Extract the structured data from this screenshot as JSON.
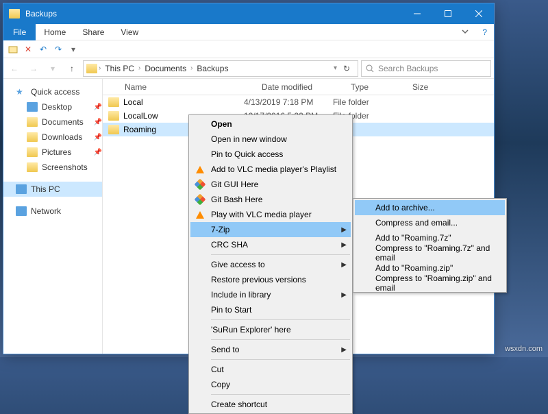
{
  "titlebar": {
    "title": "Backups"
  },
  "menubar": {
    "file": "File",
    "home": "Home",
    "share": "Share",
    "view": "View"
  },
  "address": {
    "crumb1": "This PC",
    "crumb2": "Documents",
    "crumb3": "Backups",
    "search_placeholder": "Search Backups"
  },
  "sidebar": {
    "quick_access": "Quick access",
    "desktop": "Desktop",
    "documents": "Documents",
    "downloads": "Downloads",
    "pictures": "Pictures",
    "screenshots": "Screenshots",
    "this_pc": "This PC",
    "network": "Network"
  },
  "columns": {
    "name": "Name",
    "date": "Date modified",
    "type": "Type",
    "size": "Size"
  },
  "rows": [
    {
      "name": "Local",
      "date": "4/13/2019 7:18 PM",
      "type": "File folder"
    },
    {
      "name": "LocalLow",
      "date": "12/17/2016 5:22 PM",
      "type": "File folder"
    },
    {
      "name": "Roaming",
      "date": "",
      "type": ""
    }
  ],
  "context_menu": {
    "open": "Open",
    "open_new_window": "Open in new window",
    "pin_quick": "Pin to Quick access",
    "vlc_playlist": "Add to VLC media player's Playlist",
    "git_gui": "Git GUI Here",
    "git_bash": "Git Bash Here",
    "vlc_play": "Play with VLC media player",
    "seven_zip": "7-Zip",
    "crc_sha": "CRC SHA",
    "give_access": "Give access to",
    "restore_prev": "Restore previous versions",
    "include_lib": "Include in library",
    "pin_start": "Pin to Start",
    "surun": "'SuRun Explorer' here",
    "send_to": "Send to",
    "cut": "Cut",
    "copy": "Copy",
    "create_shortcut": "Create shortcut"
  },
  "submenu": {
    "add_archive": "Add to archive...",
    "compress_email": "Compress and email...",
    "add_7z": "Add to \"Roaming.7z\"",
    "compress_7z_email": "Compress to \"Roaming.7z\" and email",
    "add_zip": "Add to \"Roaming.zip\"",
    "compress_zip_email": "Compress to \"Roaming.zip\" and email"
  },
  "watermark": "wsxdn.com"
}
